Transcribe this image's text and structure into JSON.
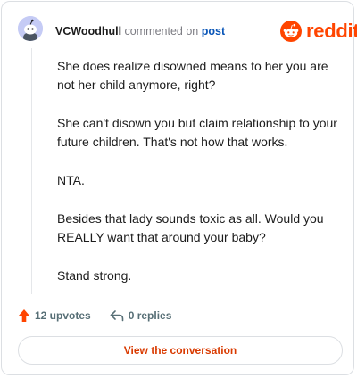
{
  "header": {
    "username": "VCWoodhull",
    "action_text": "commented on",
    "post_link": "post"
  },
  "brand": {
    "logo_text": "reddit",
    "accent_color": "#ff4500"
  },
  "comment": {
    "paragraphs": [
      "She does realize disowned means to her you are not her child anymore, right?",
      "She can't disown you but claim relationship to your future children. That's not how that works.",
      "NTA.",
      "Besides that lady sounds toxic as all. Would you REALLY want that around your baby?",
      "Stand strong."
    ]
  },
  "actions": {
    "upvotes_label": "12 upvotes",
    "replies_label": "0 replies"
  },
  "cta": {
    "label": "View the conversation"
  },
  "icons": {
    "avatar": "snoo-avatar-icon",
    "logo": "reddit-logo-icon",
    "upvote": "upvote-arrow-icon",
    "reply": "reply-arrow-icon"
  }
}
